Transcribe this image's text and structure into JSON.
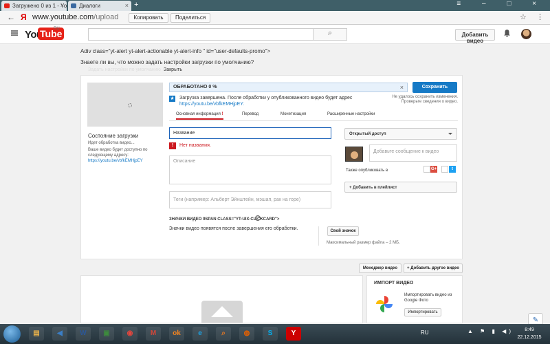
{
  "browser": {
    "tabs": [
      {
        "label": "Загружено 0 из 1 - Yo",
        "close": "×"
      },
      {
        "label": "Диалоги",
        "close": "×"
      }
    ],
    "new_tab": "+",
    "window_controls": "≡ – □ ×",
    "back": "←",
    "yandex_letter": "Я",
    "url_domain": "www.youtube.com",
    "url_path": "/upload",
    "copy_label": "Копировать",
    "share_label": "Поделиться",
    "star": "☆",
    "menu": "⋮"
  },
  "masthead": {
    "logo_you": "You",
    "logo_tube": "Tube",
    "logo_region": "RU",
    "search_placeholder": "",
    "search_icon": "⌕",
    "add_video_label": "Добавить видео",
    "bell_icon": "🔔"
  },
  "promo": {
    "code_text": "Adiv class=\"yt-alert yt-alert-actionable yt-alert-info \" id=\"user-defaults-promo\">",
    "question": "Знаете ли вы, что можно задать настройки загрузки по умолчанию?",
    "hidden_link": "Задать настройки по умолчанию",
    "close_label": "Закрыть"
  },
  "upload": {
    "progress_label": "ОБРАБОТАНО 0 %",
    "progress_percent": 0,
    "progress_close": "×",
    "save_label": "Сохранить",
    "unsaved_note": "Не удалось сохранить изменения. Проверьте сведения о видео.",
    "done_icon": "★",
    "done_text": "Загрузка завершена. После обработки у опубликованного видео будет адрес",
    "done_url": "https://youtu.be/vbfkEMHjpEY."
  },
  "status": {
    "title": "Состояние загрузки",
    "processing": "Идет обработка видео...",
    "available_text": "Ваше видео будет доступно по следующему адресу:",
    "url": "https://youtu.be/vbfkEMHjpEY"
  },
  "tabs": [
    {
      "label": "Основная информация",
      "warn": "!",
      "active": true
    },
    {
      "label": "Перевод"
    },
    {
      "label": "Монетизация"
    },
    {
      "label": "Расширенные настройки"
    }
  ],
  "form": {
    "title_placeholder": "Название",
    "error_icon": "!",
    "error_text": "Нет названия.",
    "description_placeholder": "Описание",
    "tags_placeholder": "Теги (например: Альберт Эйнштейн, мэшап, рак на горе)",
    "thumbs_title": "ЗНАЧКИ ВИДЕО 9SPAN CLASS=\"YT-UIX-CLICKCARD\">",
    "help_icon": "?",
    "thumbs_note": "Значки видео появятся после завершения его обработки.",
    "own_thumb_label": "Свой значок",
    "max_size": "Максимальный размер файла – 2 МБ."
  },
  "sidebar": {
    "privacy_value": "Открытый доступ",
    "message_placeholder": "Добавьте сообщение к видео",
    "also_publish": "Также опубликовать в",
    "google_plus": "G+",
    "twitter": "t",
    "playlist_label": "+ Добавить в плейлист"
  },
  "bottom": {
    "manager_label": "Менеджер видео",
    "add_other_label": "+ Добавить другое видео",
    "import_title": "ИМПОРТ ВИДЕО",
    "import_desc": "Импортировать видео из Google Фото",
    "import_button": "Импортировать"
  },
  "taskbar": {
    "lang": "RU",
    "tray": "▲ ⚑ ▮ ◀)",
    "time": "8:49",
    "date": "22.12.2015",
    "apps": [
      {
        "name": "start-button"
      },
      {
        "name": "explorer-app",
        "glyph": "▤",
        "color": "#e8b14a"
      },
      {
        "name": "media-app",
        "glyph": "◀",
        "color": "#3a7ec6"
      },
      {
        "name": "word-app",
        "glyph": "W",
        "color": "#2b5797"
      },
      {
        "name": "terminal-app",
        "glyph": "▣",
        "color": "#3d8a3d"
      },
      {
        "name": "chrome-app",
        "glyph": "◉",
        "color": "#e8453c"
      },
      {
        "name": "gmail-app",
        "glyph": "M",
        "color": "#d44638"
      },
      {
        "name": "ok-app",
        "glyph": "ok",
        "color": "#f48420"
      },
      {
        "name": "ie-app",
        "glyph": "e",
        "color": "#1ba1e2"
      },
      {
        "name": "search-app",
        "glyph": "⌕",
        "color": "#e87722"
      },
      {
        "name": "firefox-app",
        "glyph": "◍",
        "color": "#e66000"
      },
      {
        "name": "skype-app",
        "glyph": "S",
        "color": "#00aff0"
      },
      {
        "name": "yandex-app",
        "glyph": "Y",
        "color": "#ffffff"
      }
    ],
    "chat_icon": "✎"
  },
  "colors": {
    "youtube_red": "#e62117",
    "link_blue": "#167ac6",
    "error_red": "#cc181e"
  }
}
